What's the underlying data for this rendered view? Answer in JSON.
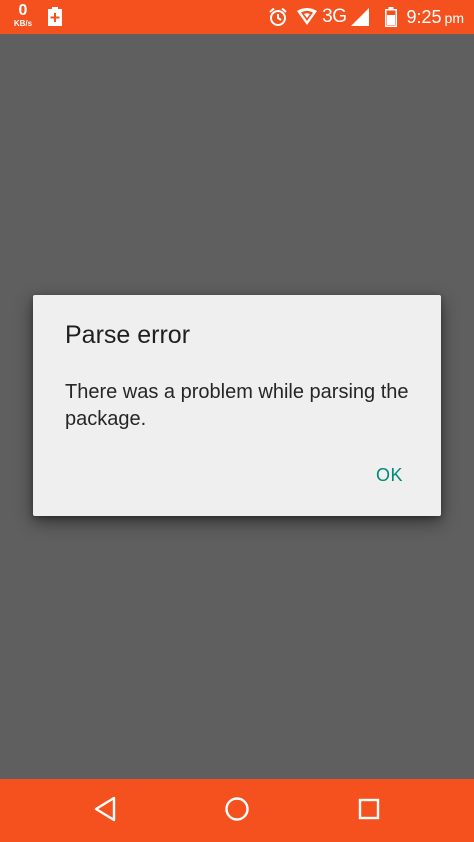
{
  "status_bar": {
    "net_speed_value": "0",
    "net_speed_unit": "KB/s",
    "network_type": "3G",
    "time": "9:25",
    "time_period": "pm",
    "icons": [
      "battery-charge-icon",
      "alarm-icon",
      "hotspot-icon",
      "signal-icon",
      "battery-icon"
    ],
    "background_color": "#f4511e"
  },
  "dialog": {
    "title": "Parse error",
    "message": "There was a problem while parsing the package.",
    "ok_label": "OK",
    "ok_color": "#00897b"
  },
  "nav_bar": {
    "icons": [
      "back-icon",
      "home-icon",
      "recent-apps-icon"
    ]
  }
}
